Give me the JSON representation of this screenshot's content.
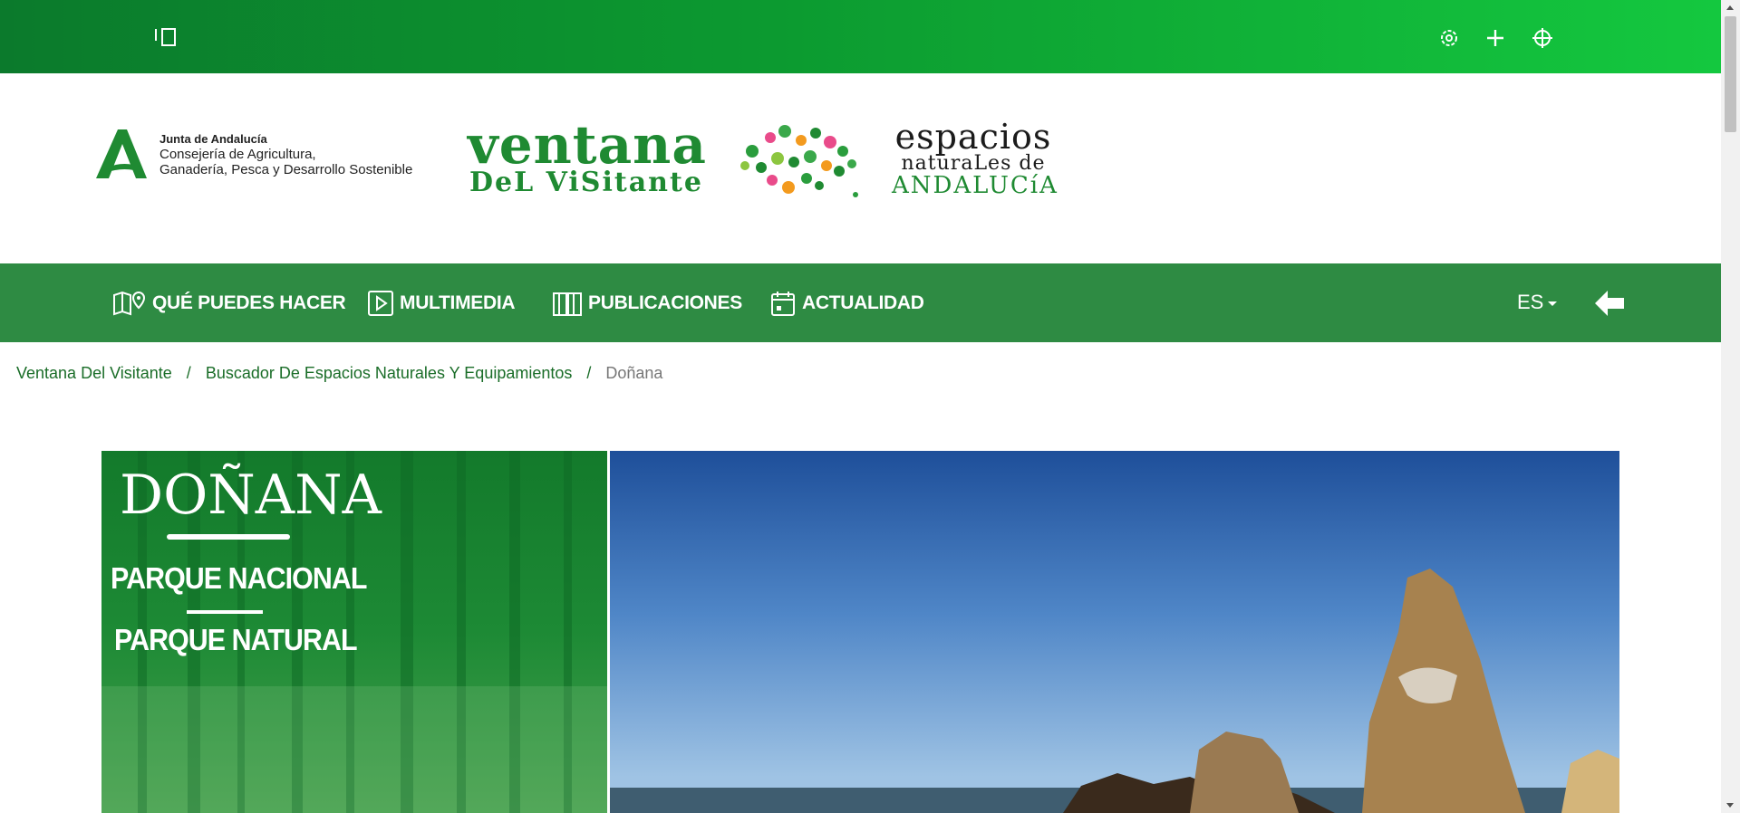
{
  "topbar": {
    "icons": [
      "sidebar-toggle-icon",
      "settings-icon",
      "plus-icon",
      "crosshair-icon"
    ]
  },
  "header": {
    "junta": {
      "line1": "Junta de Andalucía",
      "line2": "Consejería de Agricultura,",
      "line3": "Ganadería, Pesca y Desarrollo Sostenible"
    },
    "ventana": {
      "line1": "ventana",
      "line2": "DeL ViSitante"
    },
    "espacios": {
      "line1": "espacios",
      "line2": "naturaLes de",
      "line3": "ANDALUCíA"
    }
  },
  "nav": {
    "items": [
      {
        "label": "QUÉ PUEDES HACER",
        "icon": "map-pin-icon"
      },
      {
        "label": "MULTIMEDIA",
        "icon": "play-icon"
      },
      {
        "label": "PUBLICACIONES",
        "icon": "book-icon"
      },
      {
        "label": "ACTUALIDAD",
        "icon": "calendar-icon"
      }
    ],
    "lang": "ES",
    "back_icon": "arrow-left-icon"
  },
  "breadcrumb": {
    "items": [
      "Ventana Del Visitante",
      "Buscador De Espacios Naturales Y Equipamientos"
    ],
    "separator": "/",
    "current": "Doñana"
  },
  "hero": {
    "title": "DOÑANA",
    "subtitle1": "PARQUE NACIONAL",
    "subtitle2": "PARQUE NATURAL"
  },
  "colors": {
    "topbar_start": "#0b7a2c",
    "topbar_end": "#14c83f",
    "nav_bg": "#2e8b43",
    "link": "#1a6d28"
  }
}
